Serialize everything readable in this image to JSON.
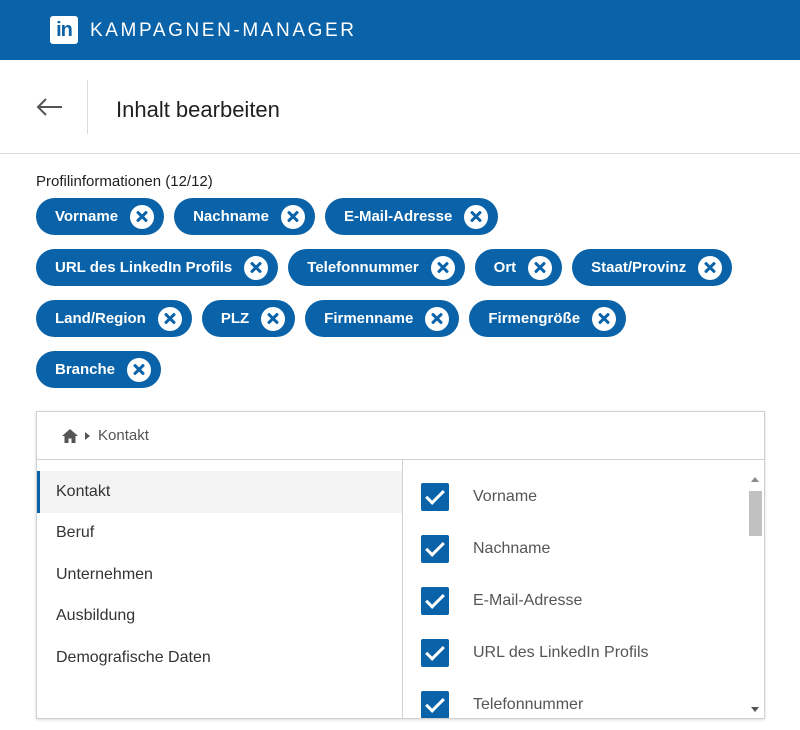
{
  "app": {
    "logo_text": "in",
    "title": "KAMPAGNEN-MANAGER",
    "brand_color": "#0a63a8"
  },
  "header": {
    "back_icon": "arrow-left-icon",
    "title": "Inhalt bearbeiten"
  },
  "profile_info": {
    "label": "Profilinformationen (12/12)",
    "chip_rows": [
      [
        "Vorname",
        "Nachname",
        "E-Mail-Adresse"
      ],
      [
        "URL des LinkedIn Profils",
        "Telefonnummer",
        "Ort",
        "Staat/Provinz"
      ],
      [
        "Land/Region",
        "PLZ",
        "Firmenname",
        "Firmengröße"
      ],
      [
        "Branche"
      ]
    ]
  },
  "panel": {
    "breadcrumb": {
      "home_icon": "home-icon",
      "current": "Kontakt"
    },
    "categories": [
      "Kontakt",
      "Beruf",
      "Unternehmen",
      "Ausbildung",
      "Demografische Daten"
    ],
    "active_category": "Kontakt",
    "options": [
      {
        "label": "Vorname",
        "checked": true
      },
      {
        "label": "Nachname",
        "checked": true
      },
      {
        "label": "E-Mail-Adresse",
        "checked": true
      },
      {
        "label": "URL des LinkedIn Profils",
        "checked": true
      },
      {
        "label": "Telefonnummer",
        "checked": true
      }
    ]
  }
}
